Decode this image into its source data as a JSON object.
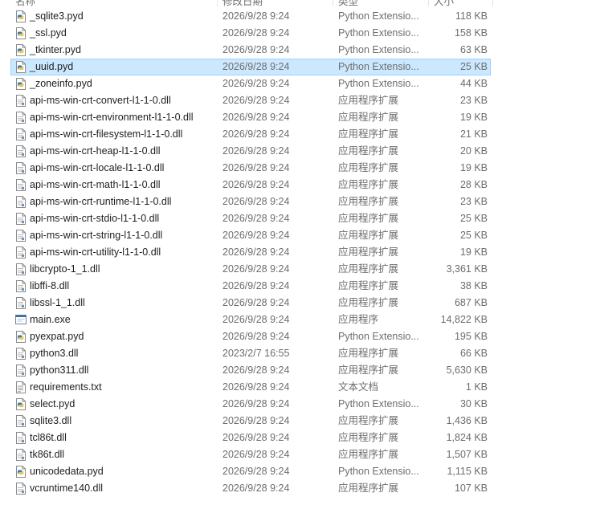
{
  "columns": {
    "name": "名称",
    "date": "修改日期",
    "type": "类型",
    "size": "大小"
  },
  "selected_index": 3,
  "files": [
    {
      "name": "_sqlite3.pyd",
      "date": "2026/9/28 9:24",
      "type": "Python Extensio...",
      "size": "118 KB",
      "icon": "python-file-icon"
    },
    {
      "name": "_ssl.pyd",
      "date": "2026/9/28 9:24",
      "type": "Python Extensio...",
      "size": "158 KB",
      "icon": "python-file-icon"
    },
    {
      "name": "_tkinter.pyd",
      "date": "2026/9/28 9:24",
      "type": "Python Extensio...",
      "size": "63 KB",
      "icon": "python-file-icon"
    },
    {
      "name": "_uuid.pyd",
      "date": "2026/9/28 9:24",
      "type": "Python Extensio...",
      "size": "25 KB",
      "icon": "python-file-icon"
    },
    {
      "name": "_zoneinfo.pyd",
      "date": "2026/9/28 9:24",
      "type": "Python Extensio...",
      "size": "44 KB",
      "icon": "python-file-icon"
    },
    {
      "name": "api-ms-win-crt-convert-l1-1-0.dll",
      "date": "2026/9/28 9:24",
      "type": "应用程序扩展",
      "size": "23 KB",
      "icon": "dll-file-icon"
    },
    {
      "name": "api-ms-win-crt-environment-l1-1-0.dll",
      "date": "2026/9/28 9:24",
      "type": "应用程序扩展",
      "size": "19 KB",
      "icon": "dll-file-icon"
    },
    {
      "name": "api-ms-win-crt-filesystem-l1-1-0.dll",
      "date": "2026/9/28 9:24",
      "type": "应用程序扩展",
      "size": "21 KB",
      "icon": "dll-file-icon"
    },
    {
      "name": "api-ms-win-crt-heap-l1-1-0.dll",
      "date": "2026/9/28 9:24",
      "type": "应用程序扩展",
      "size": "20 KB",
      "icon": "dll-file-icon"
    },
    {
      "name": "api-ms-win-crt-locale-l1-1-0.dll",
      "date": "2026/9/28 9:24",
      "type": "应用程序扩展",
      "size": "19 KB",
      "icon": "dll-file-icon"
    },
    {
      "name": "api-ms-win-crt-math-l1-1-0.dll",
      "date": "2026/9/28 9:24",
      "type": "应用程序扩展",
      "size": "28 KB",
      "icon": "dll-file-icon"
    },
    {
      "name": "api-ms-win-crt-runtime-l1-1-0.dll",
      "date": "2026/9/28 9:24",
      "type": "应用程序扩展",
      "size": "23 KB",
      "icon": "dll-file-icon"
    },
    {
      "name": "api-ms-win-crt-stdio-l1-1-0.dll",
      "date": "2026/9/28 9:24",
      "type": "应用程序扩展",
      "size": "25 KB",
      "icon": "dll-file-icon"
    },
    {
      "name": "api-ms-win-crt-string-l1-1-0.dll",
      "date": "2026/9/28 9:24",
      "type": "应用程序扩展",
      "size": "25 KB",
      "icon": "dll-file-icon"
    },
    {
      "name": "api-ms-win-crt-utility-l1-1-0.dll",
      "date": "2026/9/28 9:24",
      "type": "应用程序扩展",
      "size": "19 KB",
      "icon": "dll-file-icon"
    },
    {
      "name": "libcrypto-1_1.dll",
      "date": "2026/9/28 9:24",
      "type": "应用程序扩展",
      "size": "3,361 KB",
      "icon": "dll-file-icon"
    },
    {
      "name": "libffi-8.dll",
      "date": "2026/9/28 9:24",
      "type": "应用程序扩展",
      "size": "38 KB",
      "icon": "dll-file-icon"
    },
    {
      "name": "libssl-1_1.dll",
      "date": "2026/9/28 9:24",
      "type": "应用程序扩展",
      "size": "687 KB",
      "icon": "dll-file-icon"
    },
    {
      "name": "main.exe",
      "date": "2026/9/28 9:24",
      "type": "应用程序",
      "size": "14,822 KB",
      "icon": "exe-file-icon"
    },
    {
      "name": "pyexpat.pyd",
      "date": "2026/9/28 9:24",
      "type": "Python Extensio...",
      "size": "195 KB",
      "icon": "python-file-icon"
    },
    {
      "name": "python3.dll",
      "date": "2023/2/7 16:55",
      "type": "应用程序扩展",
      "size": "66 KB",
      "icon": "dll-file-icon"
    },
    {
      "name": "python311.dll",
      "date": "2026/9/28 9:24",
      "type": "应用程序扩展",
      "size": "5,630 KB",
      "icon": "dll-file-icon"
    },
    {
      "name": "requirements.txt",
      "date": "2026/9/28 9:24",
      "type": "文本文档",
      "size": "1 KB",
      "icon": "text-file-icon"
    },
    {
      "name": "select.pyd",
      "date": "2026/9/28 9:24",
      "type": "Python Extensio...",
      "size": "30 KB",
      "icon": "python-file-icon"
    },
    {
      "name": "sqlite3.dll",
      "date": "2026/9/28 9:24",
      "type": "应用程序扩展",
      "size": "1,436 KB",
      "icon": "dll-file-icon"
    },
    {
      "name": "tcl86t.dll",
      "date": "2026/9/28 9:24",
      "type": "应用程序扩展",
      "size": "1,824 KB",
      "icon": "dll-file-icon"
    },
    {
      "name": "tk86t.dll",
      "date": "2026/9/28 9:24",
      "type": "应用程序扩展",
      "size": "1,507 KB",
      "icon": "dll-file-icon"
    },
    {
      "name": "unicodedata.pyd",
      "date": "2026/9/28 9:24",
      "type": "Python Extensio...",
      "size": "1,115 KB",
      "icon": "python-file-icon"
    },
    {
      "name": "vcruntime140.dll",
      "date": "2026/9/28 9:24",
      "type": "应用程序扩展",
      "size": "107 KB",
      "icon": "dll-file-icon"
    }
  ]
}
